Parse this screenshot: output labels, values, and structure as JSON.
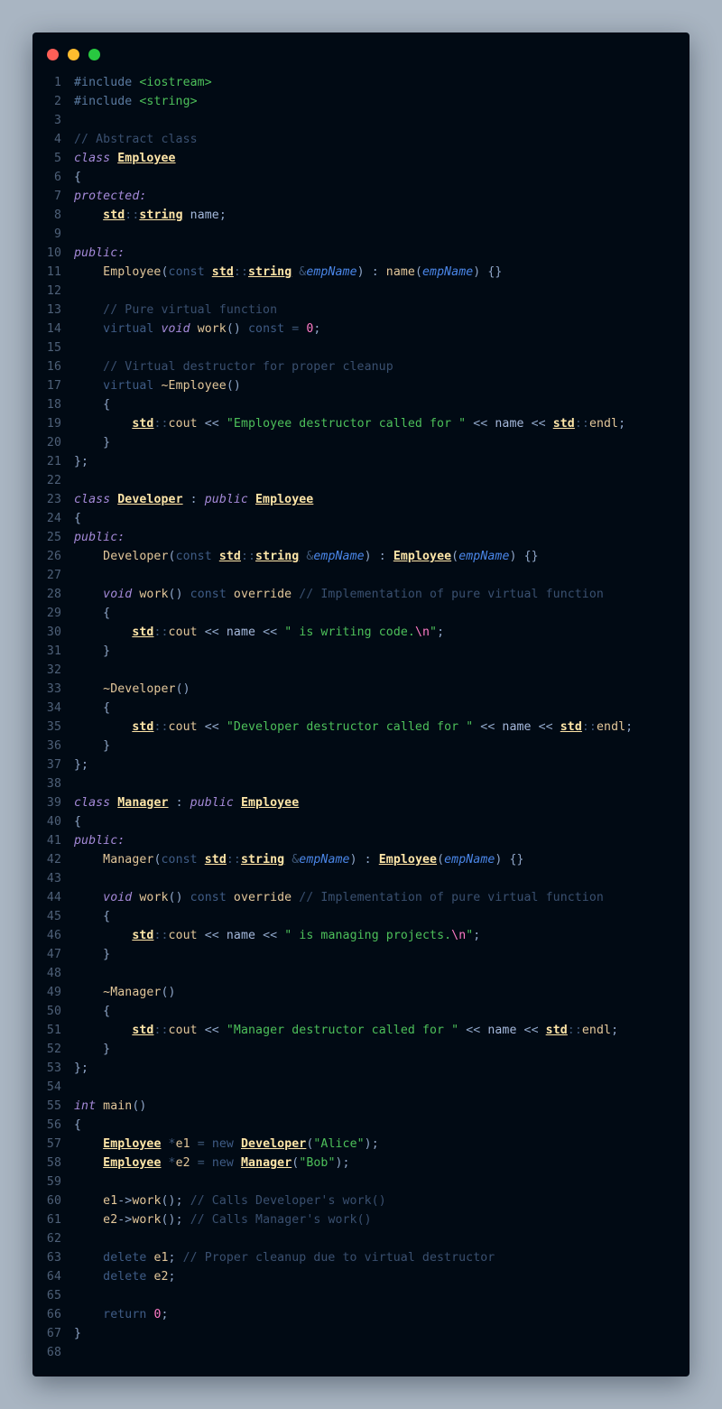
{
  "window": {
    "controls": [
      "close",
      "minimize",
      "maximize"
    ],
    "colors": {
      "close": "#ff5f57",
      "minimize": "#febc2e",
      "maximize": "#28c840",
      "background": "#010a14"
    }
  },
  "editor": {
    "language": "C++",
    "lines": [
      [
        [
          "pre",
          "#include "
        ],
        [
          "inc",
          "<iostream>"
        ]
      ],
      [
        [
          "pre",
          "#include "
        ],
        [
          "inc",
          "<string>"
        ]
      ],
      [],
      [
        [
          "cmt",
          "// Abstract class"
        ]
      ],
      [
        [
          "kw",
          "class "
        ],
        [
          "type",
          "Employee"
        ]
      ],
      [
        [
          "p",
          "{"
        ]
      ],
      [
        [
          "kw",
          "protected:"
        ]
      ],
      [
        [
          "p",
          "    "
        ],
        [
          "type",
          "std"
        ],
        [
          "op",
          "::"
        ],
        [
          "type",
          "string"
        ],
        [
          "id",
          " name"
        ],
        [
          "p",
          ";"
        ]
      ],
      [],
      [
        [
          "kw",
          "public:"
        ]
      ],
      [
        [
          "fn",
          "    Employee"
        ],
        [
          "p",
          "("
        ],
        [
          "kw2",
          "const "
        ],
        [
          "type",
          "std"
        ],
        [
          "op",
          "::"
        ],
        [
          "type",
          "string"
        ],
        [
          "op",
          " &"
        ],
        [
          "param",
          "empName"
        ],
        [
          "p",
          ") : "
        ],
        [
          "fn",
          "name"
        ],
        [
          "p",
          "("
        ],
        [
          "param",
          "empName"
        ],
        [
          "p",
          ") {}"
        ]
      ],
      [],
      [
        [
          "cmt",
          "    // Pure virtual function"
        ]
      ],
      [
        [
          "kw2",
          "    virtual "
        ],
        [
          "kw",
          "void "
        ],
        [
          "fn",
          "work"
        ],
        [
          "p",
          "() "
        ],
        [
          "kw2",
          "const "
        ],
        [
          "op",
          "= "
        ],
        [
          "num",
          "0"
        ],
        [
          "p",
          ";"
        ]
      ],
      [],
      [
        [
          "cmt",
          "    // Virtual destructor for proper cleanup"
        ]
      ],
      [
        [
          "kw2",
          "    virtual "
        ],
        [
          "fn",
          "~Employee"
        ],
        [
          "p",
          "()"
        ]
      ],
      [
        [
          "p",
          "    {"
        ]
      ],
      [
        [
          "p",
          "        "
        ],
        [
          "type",
          "std"
        ],
        [
          "op",
          "::"
        ],
        [
          "fn",
          "cout"
        ],
        [
          "p",
          " << "
        ],
        [
          "str",
          "\"Employee destructor called for \""
        ],
        [
          "p",
          " << "
        ],
        [
          "id",
          "name"
        ],
        [
          "p",
          " << "
        ],
        [
          "type",
          "std"
        ],
        [
          "op",
          "::"
        ],
        [
          "fn",
          "endl"
        ],
        [
          "p",
          ";"
        ]
      ],
      [
        [
          "p",
          "    }"
        ]
      ],
      [
        [
          "p",
          "};"
        ]
      ],
      [],
      [
        [
          "kw",
          "class "
        ],
        [
          "type",
          "Developer"
        ],
        [
          "p",
          " : "
        ],
        [
          "kw",
          "public "
        ],
        [
          "type",
          "Employee"
        ]
      ],
      [
        [
          "p",
          "{"
        ]
      ],
      [
        [
          "kw",
          "public:"
        ]
      ],
      [
        [
          "fn",
          "    Developer"
        ],
        [
          "p",
          "("
        ],
        [
          "kw2",
          "const "
        ],
        [
          "type",
          "std"
        ],
        [
          "op",
          "::"
        ],
        [
          "type",
          "string"
        ],
        [
          "op",
          " &"
        ],
        [
          "param",
          "empName"
        ],
        [
          "p",
          ") : "
        ],
        [
          "type",
          "Employee"
        ],
        [
          "p",
          "("
        ],
        [
          "param",
          "empName"
        ],
        [
          "p",
          ") {}"
        ]
      ],
      [],
      [
        [
          "kw",
          "    void "
        ],
        [
          "fn",
          "work"
        ],
        [
          "p",
          "() "
        ],
        [
          "kw2",
          "const "
        ],
        [
          "fn",
          "override "
        ],
        [
          "cmt",
          "// Implementation of pure virtual function"
        ]
      ],
      [
        [
          "p",
          "    {"
        ]
      ],
      [
        [
          "p",
          "        "
        ],
        [
          "type",
          "std"
        ],
        [
          "op",
          "::"
        ],
        [
          "fn",
          "cout"
        ],
        [
          "p",
          " << "
        ],
        [
          "id",
          "name"
        ],
        [
          "p",
          " << "
        ],
        [
          "str",
          "\" is writing code."
        ],
        [
          "esc",
          "\\n"
        ],
        [
          "str",
          "\""
        ],
        [
          "p",
          ";"
        ]
      ],
      [
        [
          "p",
          "    }"
        ]
      ],
      [],
      [
        [
          "fn",
          "    ~Developer"
        ],
        [
          "p",
          "()"
        ]
      ],
      [
        [
          "p",
          "    {"
        ]
      ],
      [
        [
          "p",
          "        "
        ],
        [
          "type",
          "std"
        ],
        [
          "op",
          "::"
        ],
        [
          "fn",
          "cout"
        ],
        [
          "p",
          " << "
        ],
        [
          "str",
          "\"Developer destructor called for \""
        ],
        [
          "p",
          " << "
        ],
        [
          "id",
          "name"
        ],
        [
          "p",
          " << "
        ],
        [
          "type",
          "std"
        ],
        [
          "op",
          "::"
        ],
        [
          "fn",
          "endl"
        ],
        [
          "p",
          ";"
        ]
      ],
      [
        [
          "p",
          "    }"
        ]
      ],
      [
        [
          "p",
          "};"
        ]
      ],
      [],
      [
        [
          "kw",
          "class "
        ],
        [
          "type",
          "Manager"
        ],
        [
          "p",
          " : "
        ],
        [
          "kw",
          "public "
        ],
        [
          "type",
          "Employee"
        ]
      ],
      [
        [
          "p",
          "{"
        ]
      ],
      [
        [
          "kw",
          "public:"
        ]
      ],
      [
        [
          "fn",
          "    Manager"
        ],
        [
          "p",
          "("
        ],
        [
          "kw2",
          "const "
        ],
        [
          "type",
          "std"
        ],
        [
          "op",
          "::"
        ],
        [
          "type",
          "string"
        ],
        [
          "op",
          " &"
        ],
        [
          "param",
          "empName"
        ],
        [
          "p",
          ") : "
        ],
        [
          "type",
          "Employee"
        ],
        [
          "p",
          "("
        ],
        [
          "param",
          "empName"
        ],
        [
          "p",
          ") {}"
        ]
      ],
      [],
      [
        [
          "kw",
          "    void "
        ],
        [
          "fn",
          "work"
        ],
        [
          "p",
          "() "
        ],
        [
          "kw2",
          "const "
        ],
        [
          "fn",
          "override "
        ],
        [
          "cmt",
          "// Implementation of pure virtual function"
        ]
      ],
      [
        [
          "p",
          "    {"
        ]
      ],
      [
        [
          "p",
          "        "
        ],
        [
          "type",
          "std"
        ],
        [
          "op",
          "::"
        ],
        [
          "fn",
          "cout"
        ],
        [
          "p",
          " << "
        ],
        [
          "id",
          "name"
        ],
        [
          "p",
          " << "
        ],
        [
          "str",
          "\" is managing projects."
        ],
        [
          "esc",
          "\\n"
        ],
        [
          "str",
          "\""
        ],
        [
          "p",
          ";"
        ]
      ],
      [
        [
          "p",
          "    }"
        ]
      ],
      [],
      [
        [
          "fn",
          "    ~Manager"
        ],
        [
          "p",
          "()"
        ]
      ],
      [
        [
          "p",
          "    {"
        ]
      ],
      [
        [
          "p",
          "        "
        ],
        [
          "type",
          "std"
        ],
        [
          "op",
          "::"
        ],
        [
          "fn",
          "cout"
        ],
        [
          "p",
          " << "
        ],
        [
          "str",
          "\"Manager destructor called for \""
        ],
        [
          "p",
          " << "
        ],
        [
          "id",
          "name"
        ],
        [
          "p",
          " << "
        ],
        [
          "type",
          "std"
        ],
        [
          "op",
          "::"
        ],
        [
          "fn",
          "endl"
        ],
        [
          "p",
          ";"
        ]
      ],
      [
        [
          "p",
          "    }"
        ]
      ],
      [
        [
          "p",
          "};"
        ]
      ],
      [],
      [
        [
          "kw",
          "int "
        ],
        [
          "fn",
          "main"
        ],
        [
          "p",
          "()"
        ]
      ],
      [
        [
          "p",
          "{"
        ]
      ],
      [
        [
          "p",
          "    "
        ],
        [
          "type",
          "Employee"
        ],
        [
          "op",
          " *"
        ],
        [
          "fn",
          "e1"
        ],
        [
          "op",
          " = "
        ],
        [
          "kw2",
          "new "
        ],
        [
          "type",
          "Developer"
        ],
        [
          "p",
          "("
        ],
        [
          "str",
          "\"Alice\""
        ],
        [
          "p",
          ");"
        ]
      ],
      [
        [
          "p",
          "    "
        ],
        [
          "type",
          "Employee"
        ],
        [
          "op",
          " *"
        ],
        [
          "fn",
          "e2"
        ],
        [
          "op",
          " = "
        ],
        [
          "kw2",
          "new "
        ],
        [
          "type",
          "Manager"
        ],
        [
          "p",
          "("
        ],
        [
          "str",
          "\"Bob\""
        ],
        [
          "p",
          ");"
        ]
      ],
      [],
      [
        [
          "fn",
          "    e1"
        ],
        [
          "p",
          "->"
        ],
        [
          "fn",
          "work"
        ],
        [
          "p",
          "(); "
        ],
        [
          "cmt",
          "// Calls Developer's work()"
        ]
      ],
      [
        [
          "fn",
          "    e2"
        ],
        [
          "p",
          "->"
        ],
        [
          "fn",
          "work"
        ],
        [
          "p",
          "(); "
        ],
        [
          "cmt",
          "// Calls Manager's work()"
        ]
      ],
      [],
      [
        [
          "kw2",
          "    delete "
        ],
        [
          "fn",
          "e1"
        ],
        [
          "p",
          "; "
        ],
        [
          "cmt",
          "// Proper cleanup due to virtual destructor"
        ]
      ],
      [
        [
          "kw2",
          "    delete "
        ],
        [
          "fn",
          "e2"
        ],
        [
          "p",
          ";"
        ]
      ],
      [],
      [
        [
          "kw2",
          "    return "
        ],
        [
          "num",
          "0"
        ],
        [
          "p",
          ";"
        ]
      ],
      [
        [
          "p",
          "}"
        ]
      ],
      []
    ]
  }
}
